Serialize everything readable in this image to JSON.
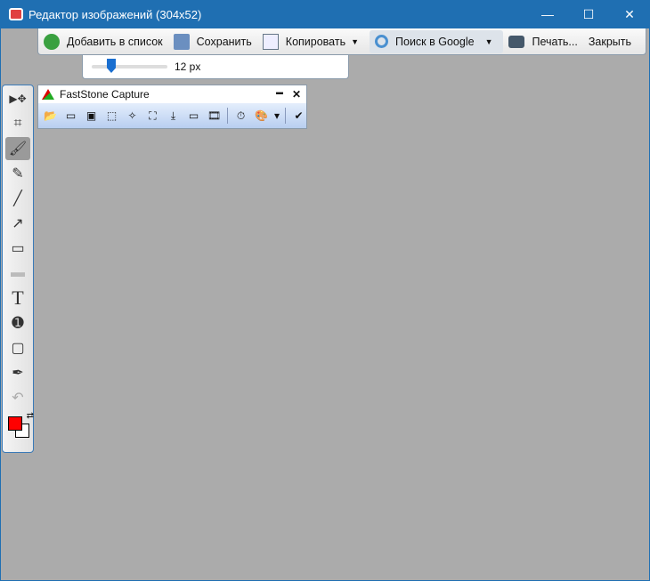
{
  "window": {
    "title": "Редактор изображений (304x52)",
    "minimize": "—",
    "maximize": "☐",
    "close": "✕"
  },
  "toolbar": {
    "add": "Добавить в список",
    "save": "Сохранить",
    "copy": "Копировать",
    "search": "Поиск в Google",
    "print": "Печать...",
    "close": "Закрыть",
    "caret": "▼"
  },
  "slider": {
    "value_label": "12 px",
    "value": 12
  },
  "tools": {
    "move": "▶✥",
    "crop": "⌗",
    "brush": "🖌",
    "highlighter": "✎",
    "line": "╱",
    "arrow": "↗",
    "rect": "▭",
    "filled_rect": "▬",
    "text": "T",
    "counter": "➊",
    "blur": "▢",
    "picker": "✒",
    "undo": "↶",
    "swap": "⇄"
  },
  "capture": {
    "title": "FastStone Capture",
    "minimize": "▬",
    "close": "✕",
    "buttons": [
      "📂",
      "▭",
      "▣",
      "⬚",
      "✧",
      "⛶",
      "⤓",
      "▭",
      "🎞",
      "⏱",
      "🎨",
      "▾",
      "✔"
    ]
  },
  "colors": {
    "foreground": "#ff0000",
    "background": "#ffffff"
  }
}
